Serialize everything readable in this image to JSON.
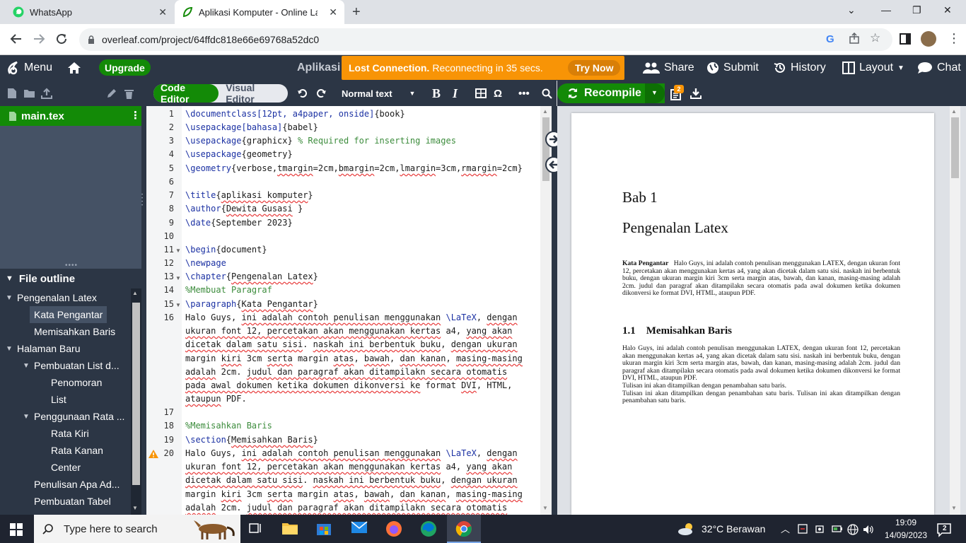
{
  "browser": {
    "tabs": [
      {
        "title": "WhatsApp"
      },
      {
        "title": "Aplikasi Komputer - Online LaTeX"
      }
    ],
    "url": "overleaf.com/project/64ffdc818e66e69768a52dc0"
  },
  "toolbar": {
    "menu": "Menu",
    "upgrade": "Upgrade",
    "project_title": "Aplikasi",
    "share": "Share",
    "submit": "Submit",
    "history": "History",
    "layout": "Layout",
    "chat": "Chat"
  },
  "alert": {
    "title": "Lost Connection.",
    "message": "Reconnecting in 35 secs.",
    "button": "Try Now",
    "color": "#f89406"
  },
  "filetree": {
    "file": "main.tex"
  },
  "outline": {
    "header": "File outline",
    "items": [
      {
        "label": "Pengenalan Latex"
      },
      {
        "label": "Kata Pengantar"
      },
      {
        "label": "Memisahkan Baris"
      },
      {
        "label": "Halaman Baru"
      },
      {
        "label": "Pembuatan List d..."
      },
      {
        "label": "Penomoran"
      },
      {
        "label": "List"
      },
      {
        "label": "Penggunaan Rata ..."
      },
      {
        "label": "Rata Kiri"
      },
      {
        "label": "Rata Kanan"
      },
      {
        "label": "Center"
      },
      {
        "label": "Penulisan Apa Ad..."
      },
      {
        "label": "Pembuatan Tabel"
      }
    ]
  },
  "editor": {
    "code_editor": "Code Editor",
    "visual_editor": "Visual Editor",
    "style": "Normal text",
    "omega": "Ω",
    "line_numbers": [
      "1",
      "2",
      "3",
      "4",
      "5",
      "6",
      "7",
      "8",
      "9",
      "10",
      "11",
      "12",
      "13",
      "14",
      "15",
      "16",
      "17",
      "18",
      "19",
      "20"
    ],
    "lines": {
      "l1a": "\\documentclass",
      "l1b": "[12pt, a4paper, onside]",
      "l1c": "{book}",
      "l2a": "\\usepackage",
      "l2b": "[bahasa]",
      "l2c": "{babel}",
      "l3a": "\\usepackage",
      "l3b": "{graphicx}",
      "l3c": " % Required for inserting images",
      "l4a": "\\usepackage",
      "l4b": "{geometry}",
      "l5a": "\\geometry",
      "l5b": "{verbose,",
      "l5c": "tmargin",
      "l5d": "=2cm,",
      "l5e": "bmargin",
      "l5f": "=2cm,",
      "l5g": "lmargin",
      "l5h": "=3cm,",
      "l5i": "rmargin",
      "l5j": "=2cm}",
      "l7a": "\\title",
      "l7b": "{",
      "l7c": "aplikasi komputer",
      "l7d": "}",
      "l8a": "\\author",
      "l8b": "{",
      "l8c": "Dewita Gusasi",
      "l8d": " }",
      "l9a": "\\date",
      "l9b": "{September 2023}",
      "l11a": "\\begin",
      "l11b": "{document}",
      "l12a": "\\newpage",
      "l13a": "\\chapter",
      "l13b": "{",
      "l13c": "Pengenalan Latex",
      "l13d": "}",
      "l14a": "%Membuat Paragraf",
      "l15a": "\\paragraph",
      "l15b": "{",
      "l15c": "Kata Pengantar",
      "l15d": "}",
      "p16_1a": "Halo Guys, ",
      "p16_1b": "ini adalah contoh penulisan menggunakan",
      "p16_1c": " \\LaTeX",
      "p16_1d": ", ",
      "p16_1e": "dengan",
      "p16_2a": "ukuran font 12, percetakan akan menggunakan kertas",
      "p16_2b": " a4, ",
      "p16_2c": "yang akan",
      "p16_3a": "dicetak dalam satu sisi",
      "p16_3b": ". ",
      "p16_3c": "naskah ini berbentuk buku",
      "p16_3d": ", ",
      "p16_3e": "dengan ukuran",
      "p16_4a": "margin ",
      "p16_4b": "kiri",
      "p16_4c": " 3cm ",
      "p16_4d": "serta",
      "p16_4e": " margin ",
      "p16_4f": "atas",
      "p16_4g": ", ",
      "p16_4h": "bawah",
      "p16_4i": ", ",
      "p16_4j": "dan kanan",
      "p16_4k": ", ",
      "p16_4l": "masing-masing",
      "p16_5a": "adalah",
      "p16_5b": " 2cm. ",
      "p16_5c": "judul dan paragraf akan ditampilakn secara otomatis",
      "p16_6a": "pada awal dokumen ketika dokumen dikonversi ke",
      "p16_6b": " format ",
      "p16_6c": "DVI",
      "p16_6d": ", HTML,",
      "p16_7a": "ataupun",
      "p16_7b": " PDF.",
      "l18a": "%Memisahkan Baris",
      "l19a": "\\section",
      "l19b": "{",
      "l19c": "Memisahkan Baris",
      "l19d": "}",
      "p20_1a": "Halo Guys, ",
      "p20_1b": "ini adalah contoh penulisan menggunakan",
      "p20_1c": " \\LaTeX",
      "p20_1d": ", ",
      "p20_1e": "dengan",
      "p20_2a": "ukuran font 12, percetakan akan menggunakan kertas",
      "p20_2b": " a4, ",
      "p20_2c": "yang akan",
      "p20_3a": "dicetak dalam satu sisi",
      "p20_3b": ". ",
      "p20_3c": "naskah ini berbentuk buku",
      "p20_3d": ", ",
      "p20_3e": "dengan ukuran",
      "p20_4a": "margin ",
      "p20_4b": "kiri",
      "p20_4c": " 3cm ",
      "p20_4d": "serta",
      "p20_4e": " margin ",
      "p20_4f": "atas",
      "p20_4g": ", ",
      "p20_4h": "bawah",
      "p20_4i": ", ",
      "p20_4j": "dan kanan",
      "p20_4k": ", ",
      "p20_4l": "masing-masing",
      "p20_5a": "adalah",
      "p20_5b": " 2cm. ",
      "p20_5c": "judul dan paragraf akan ditampilakn secara otomatis"
    }
  },
  "pdf": {
    "recompile": "Recompile",
    "badge": "2",
    "bab": "Bab 1",
    "chapter_title": "Pengenalan Latex",
    "para1_title": "Kata Pengantar",
    "para1_text": "Halo Guys, ini adalah contoh penulisan menggunakan LATEX, dengan ukuran font 12, percetakan akan menggunakan kertas a4, yang akan dicetak dalam satu sisi.  naskah ini berbentuk buku, dengan ukuran margin kiri 3cm serta margin atas, bawah, dan kanan, masing-masing adalah 2cm.  judul dan paragraf akan ditampilakn secara otomatis pada awal dokumen ketika dokumen dikonversi ke format DVI, HTML, ataupun PDF.",
    "section_num": "1.1",
    "section_title": "Memisahkan Baris",
    "sec_text": "Halo Guys, ini adalah contoh penulisan menggunakan LATEX, dengan ukuran font 12, percetakan akan menggunakan kertas a4, yang akan dicetak dalam satu sisi.  naskah ini berbentuk buku, dengan ukuran margin kiri 3cm serta margin atas, bawah, dan kanan, masing-masing adalah 2cm.  judul dan paragraf akan ditampilakn secara otomatis pada awal dokumen ketika dokumen dikonversi ke format DVI, HTML, ataupun PDF.",
    "sec_line2": "Tulisan ini akan ditampilkan dengan penambahan satu baris.",
    "sec_line3": "Tulisan ini akan ditampilkan dengan penambahan satu baris. Tulisan ini akan ditampilkan dengan penambahan satu baris."
  },
  "taskbar": {
    "search_placeholder": "Type here to search",
    "weather": "32°C  Berawan",
    "time": "19:09",
    "date": "14/09/2023",
    "notifications": "2"
  },
  "colors": {
    "overleaf_green": "#138a07",
    "overleaf_dark": "#2c3645",
    "alert_orange": "#f89406"
  }
}
